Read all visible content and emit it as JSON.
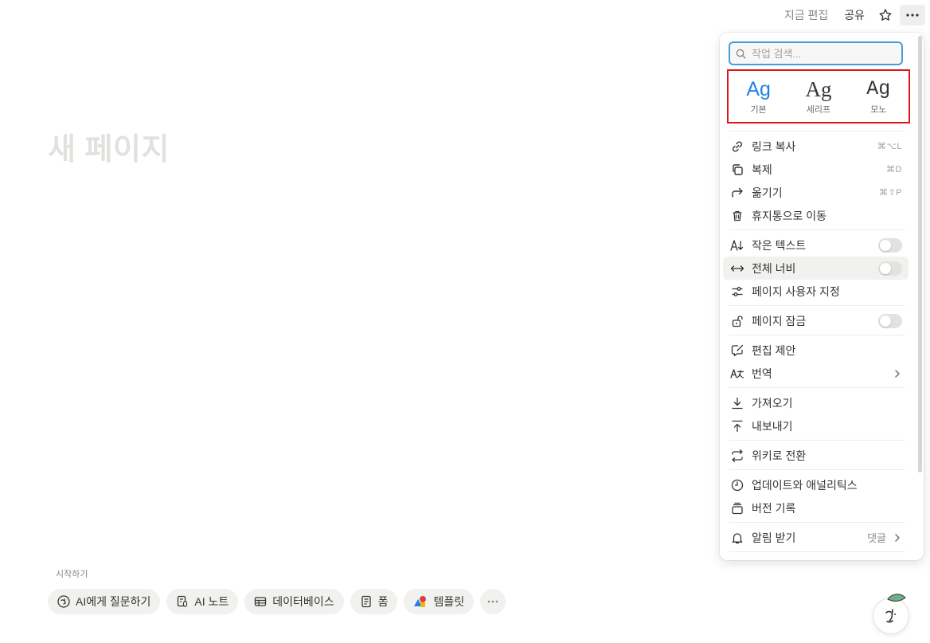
{
  "topbar": {
    "edited": "지금 편집",
    "share": "공유"
  },
  "page": {
    "title": "새 페이지"
  },
  "start": {
    "label": "시작하기",
    "chips": [
      {
        "label": "AI에게 질문하기",
        "icon": "ai-face-icon"
      },
      {
        "label": "AI 노트",
        "icon": "ai-note-icon"
      },
      {
        "label": "데이터베이스",
        "icon": "table-icon"
      },
      {
        "label": "폼",
        "icon": "form-icon"
      },
      {
        "label": "템플릿",
        "icon": "template-shapes-icon"
      }
    ]
  },
  "menu": {
    "search_placeholder": "작업 검색...",
    "fonts": [
      {
        "glyph": "Ag",
        "name": "기본"
      },
      {
        "glyph": "Ag",
        "name": "세리프"
      },
      {
        "glyph": "Ag",
        "name": "모노"
      }
    ],
    "items": {
      "copy_link": {
        "label": "링크 복사",
        "shortcut": "⌘⌥L"
      },
      "duplicate": {
        "label": "복제",
        "shortcut": "⌘D"
      },
      "move": {
        "label": "옮기기",
        "shortcut": "⌘⇧P"
      },
      "trash": {
        "label": "휴지통으로 이동"
      },
      "small_text": {
        "label": "작은 텍스트",
        "on": false
      },
      "full_width": {
        "label": "전체 너비",
        "on": false
      },
      "customize": {
        "label": "페이지 사용자 지정"
      },
      "lock": {
        "label": "페이지 잠금",
        "on": false
      },
      "suggest": {
        "label": "편집 제안"
      },
      "translate": {
        "label": "번역"
      },
      "import": {
        "label": "가져오기"
      },
      "export": {
        "label": "내보내기"
      },
      "wiki": {
        "label": "위키로 전환"
      },
      "updates": {
        "label": "업데이트와 애널리틱스"
      },
      "history": {
        "label": "버전 기록"
      },
      "notify": {
        "label": "알림 받기",
        "extra": "댓글"
      }
    }
  },
  "colors": {
    "accent": "#2383e2",
    "highlight_border": "#e0161e",
    "search_border": "#4a9ddb"
  }
}
